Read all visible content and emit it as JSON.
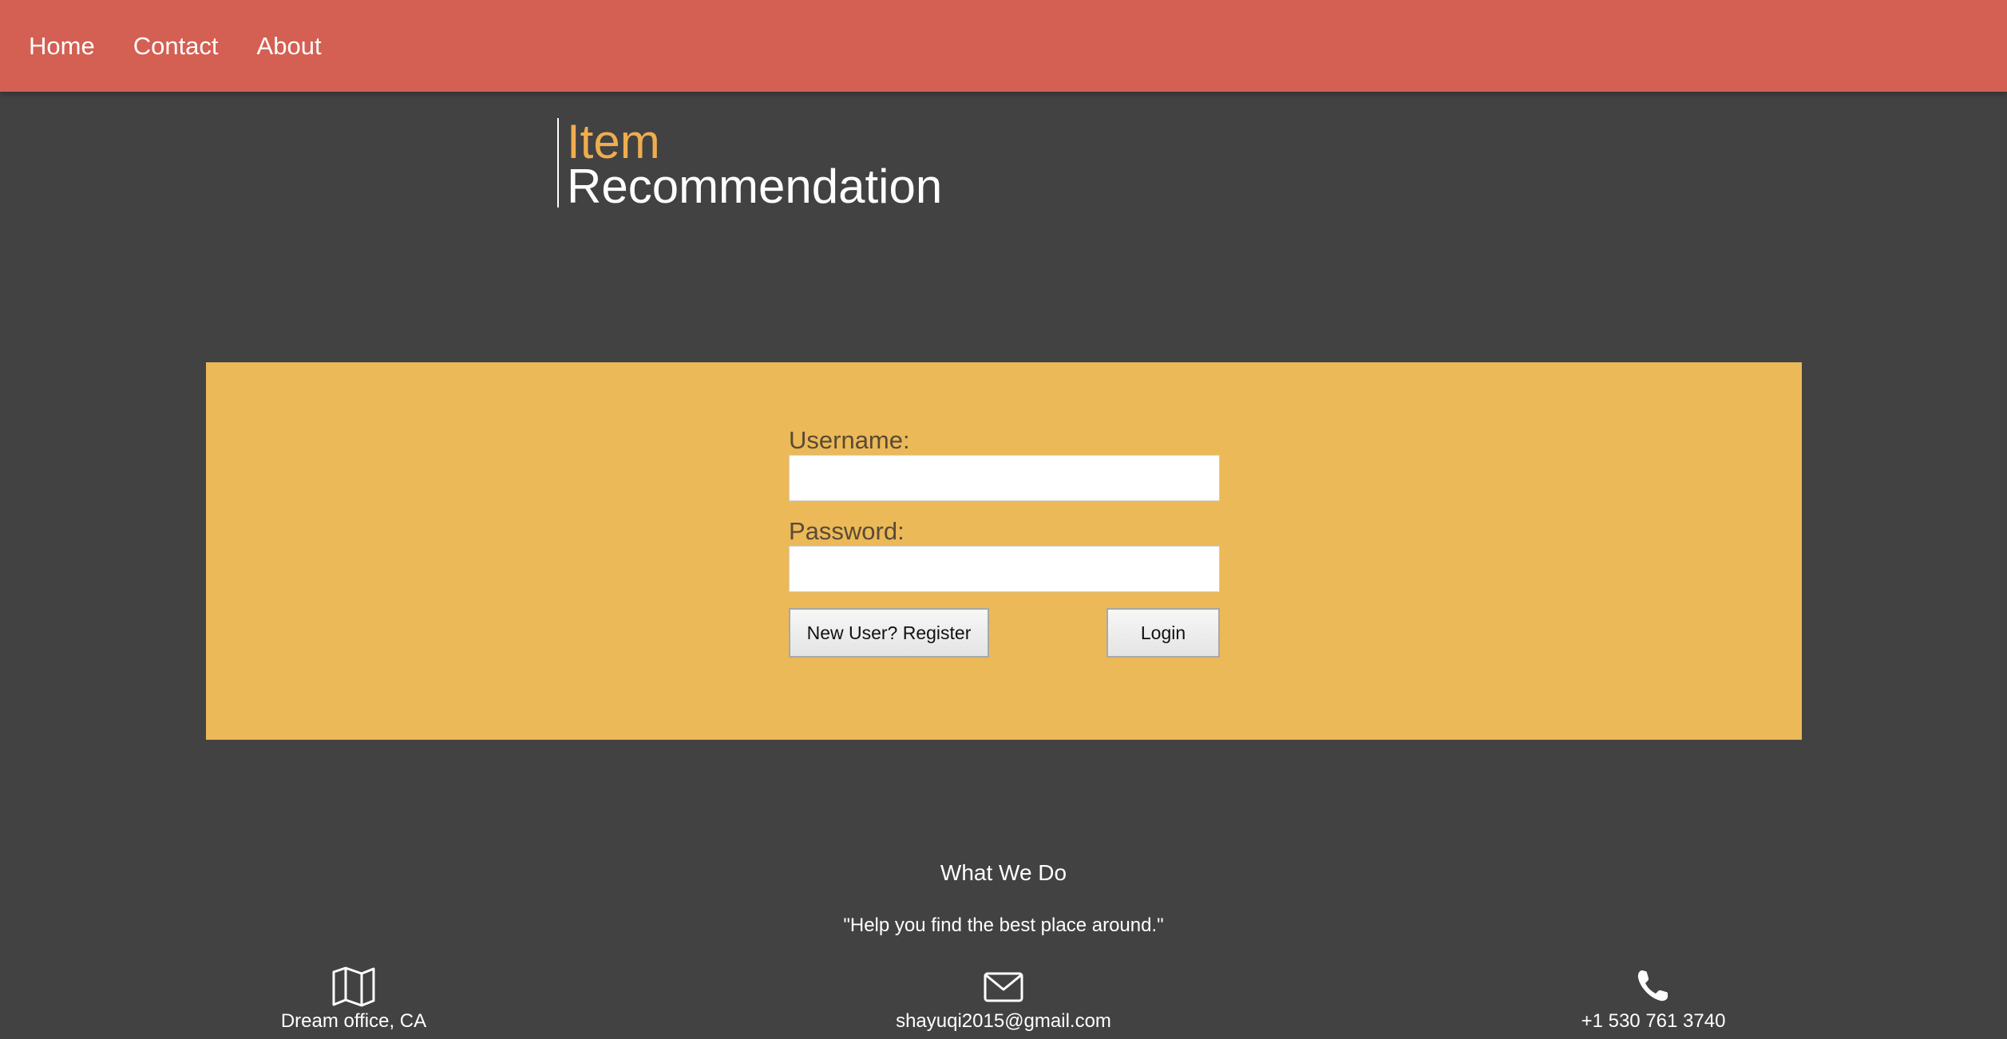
{
  "nav": {
    "items": [
      {
        "label": "Home"
      },
      {
        "label": "Contact"
      },
      {
        "label": "About"
      }
    ]
  },
  "brand": {
    "line1": "Item",
    "line2": "Recommendation"
  },
  "login": {
    "username_label": "Username:",
    "username_value": "",
    "password_label": "Password:",
    "password_value": "",
    "register_button": "New User? Register",
    "login_button": "Login"
  },
  "footer": {
    "title": "What We Do",
    "quote": "\"Help you find the best place around.\"",
    "office": {
      "icon": "map-icon",
      "text": "Dream office, CA"
    },
    "email": {
      "icon": "envelope-icon",
      "text": "shayuqi2015@gmail.com"
    },
    "phone": {
      "icon": "phone-icon",
      "text": "+1 530 761 3740"
    }
  },
  "colors": {
    "nav_bg": "#d45f53",
    "page_bg": "#424242",
    "panel_bg": "#ebb958",
    "brand_accent": "#f0ad4e"
  }
}
